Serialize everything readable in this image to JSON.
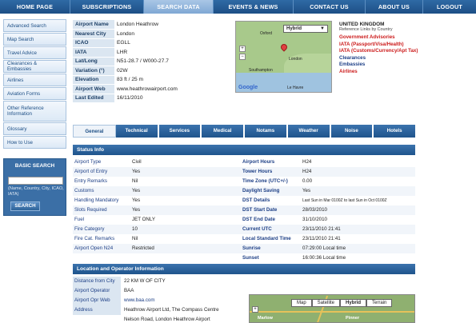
{
  "nav": [
    "HOME PAGE",
    "SUBSCRIPTIONS",
    "SEARCH DATA",
    "EVENTS & NEWS",
    "CONTACT US",
    "ABOUT US",
    "LOGOUT"
  ],
  "nav_active": "SEARCH DATA",
  "sidebar": {
    "items": [
      {
        "label": "Advanced Search"
      },
      {
        "label": "Map Search"
      },
      {
        "label": "Travel Advice"
      },
      {
        "label": "Clearances & Embassies"
      },
      {
        "label": "Airlines"
      },
      {
        "label": "Aviation Forms"
      },
      {
        "label": "Other Reference Information"
      },
      {
        "label": "Glossary"
      },
      {
        "label": "How to Use"
      }
    ]
  },
  "basic_search": {
    "title": "BASIC SEARCH",
    "placeholder": "",
    "hint": "(Name, Country, City, ICAO, IATA)",
    "button": "SEARCH"
  },
  "airport": {
    "rows": [
      {
        "label": "Airport Name",
        "value": "London Heathrow"
      },
      {
        "label": "Nearest City",
        "value": "London"
      },
      {
        "label": "ICAO",
        "value": "EGLL"
      },
      {
        "label": "IATA",
        "value": "LHR"
      },
      {
        "label": "Lat/Long",
        "value": "N51-28.7 / W000-27.7"
      },
      {
        "label": "Variation (°)",
        "value": "02W"
      },
      {
        "label": "Elevation",
        "value": "83 ft / 25 m"
      },
      {
        "label": "Airport Web",
        "value": "www.heathrowairport.com"
      },
      {
        "label": "Last Edited",
        "value": "16/11/2010"
      }
    ]
  },
  "map1": {
    "mode": "Hybrid",
    "logo": "Google",
    "labels": [
      "Southampton",
      "London",
      "Oxford",
      "Le Havre"
    ]
  },
  "country_links": {
    "country": "UNITED KINGDOM",
    "hint": "Reference Links by Country",
    "links": [
      {
        "label": "Government Advisories",
        "color": "#cc1b1b"
      },
      {
        "label": "IATA (Passport/Visa/Health)",
        "color": "#cc1b1b"
      },
      {
        "label": "IATA (Customs/Currency/Apt Tax)",
        "color": "#cc1b1b"
      },
      {
        "label": "Clearances",
        "color": "#1d3f86"
      },
      {
        "label": "Embassies",
        "color": "#1d3f86"
      },
      {
        "label": "Airlines",
        "color": "#cc1b1b"
      }
    ]
  },
  "tabs": [
    "General",
    "Technical",
    "Services",
    "Medical",
    "Notams",
    "Weather",
    "Noise",
    "Hotels"
  ],
  "tab_active": "General",
  "status_info": {
    "title": "Status Info",
    "rows": [
      {
        "l1": "Airport Type",
        "v1": "Civil",
        "l2": "Airport Hours",
        "v2": "H24"
      },
      {
        "l1": "Airport of Entry",
        "v1": "Yes",
        "l2": "Tower Hours",
        "v2": "H24"
      },
      {
        "l1": "Entry Remarks",
        "v1": "Nil",
        "l2": "Time Zone (UTC+/-)",
        "v2": "0.00"
      },
      {
        "l1": "Customs",
        "v1": "Yes",
        "l2": "Daylight Saving",
        "v2": "Yes"
      },
      {
        "l1": "Handling Mandatory",
        "v1": "Yes",
        "l2": "DST Details",
        "v2": "Last Sun in Mar 0100Z to last Sun in Oct 0100Z"
      },
      {
        "l1": "Slots Required",
        "v1": "Yes",
        "l2": "DST Start Date",
        "v2": "28/03/2010"
      },
      {
        "l1": "Fuel",
        "v1": "JET ONLY",
        "l2": "DST End Date",
        "v2": "31/10/2010"
      },
      {
        "l1": "Fire Category",
        "v1": "10",
        "l2": "Current UTC",
        "v2": "23/11/2010 21:41"
      },
      {
        "l1": "Fire Cat. Remarks",
        "v1": "Nil",
        "l2": "Local Standard Time",
        "v2": "23/11/2010 21:41"
      },
      {
        "l1": "Airport Open N24",
        "v1": "Restricted",
        "l2": "Sunrise",
        "v2": "07:29:00 Local time"
      },
      {
        "l1": "",
        "v1": "",
        "l2": "Sunset",
        "v2": "16:00:36 Local time"
      }
    ]
  },
  "location": {
    "title": "Location and Operator Information",
    "rows": [
      {
        "label": "Distance from City",
        "value": "22 KM W OF CITY"
      },
      {
        "label": "Airport Operator",
        "value": "BAA"
      },
      {
        "label": "Airport Opr Web",
        "value": "www.baa.com"
      },
      {
        "label": "Address",
        "value": "Heathrow Airport Ltd, The Compass Centre"
      },
      {
        "label": "",
        "value": "Nelson Road, London Heathrow Airport"
      }
    ]
  },
  "map2": {
    "buttons": [
      "Map",
      "Satellite",
      "Hybrid",
      "Terrain"
    ],
    "selected": "Hybrid",
    "labels": [
      "Marlow",
      "Pinner"
    ]
  }
}
